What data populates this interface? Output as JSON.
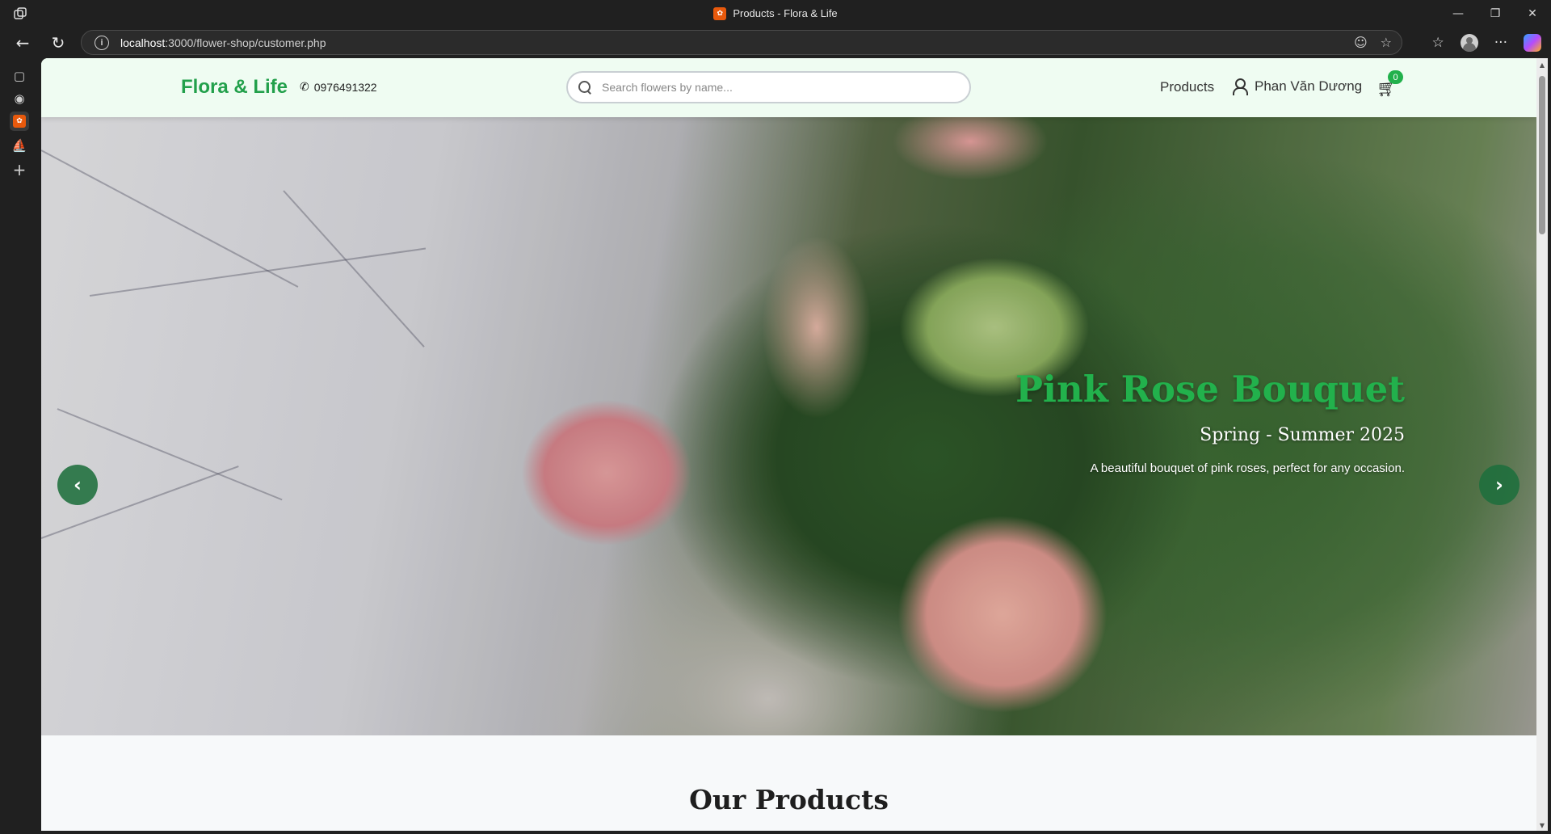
{
  "browser": {
    "tab_title": "Products - Flora & Life",
    "favicon_text": "✿",
    "url_host": "localhost",
    "url_rest": ":3000/flower-shop/customer.php",
    "icons": [
      "back-arrow-icon",
      "refresh-icon",
      "info-icon",
      "reader-icon",
      "star-icon",
      "favorites-icon",
      "profile-icon",
      "more-icon",
      "copilot-icon"
    ]
  },
  "header": {
    "brand": "Flora & Life",
    "phone": "0976491322",
    "search_placeholder": "Search flowers by name...",
    "nav_products": "Products",
    "user_name": "Phan Văn Dương",
    "cart_count": "0",
    "colors": {
      "background": "#effcf2",
      "brand": "#22a04b",
      "badge": "#22b14c"
    }
  },
  "hero": {
    "title": "Pink Rose Bouquet",
    "subtitle": "Spring - Summer 2025",
    "description": "A beautiful bouquet of pink roses, perfect for any occasion.",
    "prev_label": "‹",
    "next_label": "›",
    "colors": {
      "title": "#22b14c",
      "button": "#1e6e3c"
    }
  },
  "products": {
    "heading": "Our Products"
  }
}
